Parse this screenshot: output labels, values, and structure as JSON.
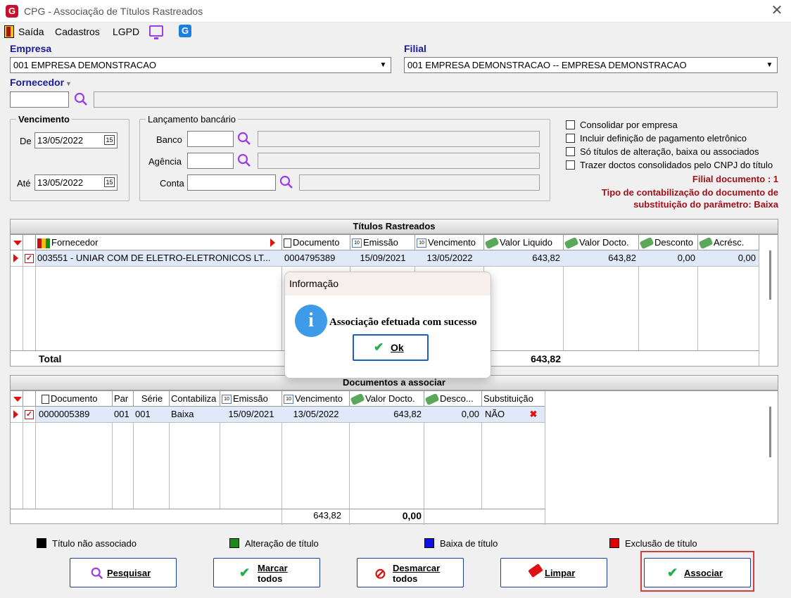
{
  "window": {
    "title": "CPG - Associação de Títulos Rastreados"
  },
  "menu": {
    "saida": "Saída",
    "cadastros": "Cadastros",
    "lgpd": "LGPD"
  },
  "empresa": {
    "label": "Empresa",
    "value": "001 EMPRESA DEMONSTRACAO"
  },
  "filial": {
    "label": "Filial",
    "value": "001 EMPRESA DEMONSTRACAO -- EMPRESA DEMONSTRACAO"
  },
  "fornecedor": {
    "label": "Fornecedor",
    "value": ""
  },
  "vencimento": {
    "legend": "Vencimento",
    "de_label": "De",
    "de_value": "13/05/2022",
    "ate_label": "Até",
    "ate_value": "13/05/2022"
  },
  "lancamento": {
    "legend": "Lançamento bancário",
    "banco_label": "Banco",
    "agencia_label": "Agência",
    "conta_label": "Conta"
  },
  "options": [
    {
      "label": "Consolidar por empresa",
      "checked": false
    },
    {
      "label": "Incluir definição de pagamento eletrônico",
      "checked": false
    },
    {
      "label": "Só títulos de alteração, baixa ou associados",
      "checked": false
    },
    {
      "label": "Trazer doctos consolidados pelo CNPJ do título",
      "checked": false
    }
  ],
  "info": {
    "filial_doc": "Filial documento : 1",
    "tipo_line1": "Tipo de contabilização do documento de",
    "tipo_line2": "substituição do parâmetro: Baixa"
  },
  "titulos": {
    "title": "Títulos Rastreados",
    "headers": [
      "Fornecedor",
      "Documento",
      "Emissão",
      "Vencimento",
      "Valor Liquido",
      "Valor Docto.",
      "Desconto",
      "Acrésc."
    ],
    "row": {
      "fornecedor": "003551 - UNIAR COM DE ELETRO-ELETRONICOS LT...",
      "documento": "0004795389",
      "emissao": "15/09/2021",
      "vencimento": "13/05/2022",
      "valor_liquido": "643,82",
      "valor_docto": "643,82",
      "desconto": "0,00",
      "acresc": "0,00"
    },
    "total_label": "Total",
    "total_value": "643,82"
  },
  "documentos": {
    "title": "Documentos a associar",
    "headers": [
      "Documento",
      "Par",
      "Série",
      "Contabiliza",
      "Emissão",
      "Vencimento",
      "Valor Docto.",
      "Desco...",
      "Substituição"
    ],
    "row": {
      "documento": "0000005389",
      "par": "001",
      "serie": "001",
      "contabiliza": "Baixa",
      "emissao": "15/09/2021",
      "vencimento": "13/05/2022",
      "valor_docto": "643,82",
      "desconto": "0,00",
      "substituicao": "NÃO"
    },
    "total_valor": "643,82",
    "total_desconto": "0,00"
  },
  "legend": [
    {
      "label": "Título não associado",
      "color": "#000000"
    },
    {
      "label": "Alteração de título",
      "color": "#1a8a1a"
    },
    {
      "label": "Baixa de título",
      "color": "#1010e0"
    },
    {
      "label": "Exclusão de título",
      "color": "#e00000"
    }
  ],
  "buttons": {
    "pesquisar": "Pesquisar",
    "marcar_1": "Marcar",
    "marcar_2": "todos",
    "desmarcar_1": "Desmarcar",
    "desmarcar_2": "todos",
    "limpar": "Limpar",
    "associar": "Associar"
  },
  "dialog": {
    "title": "Informação",
    "message": "Associação efetuada com sucesso",
    "ok": "Ok"
  }
}
